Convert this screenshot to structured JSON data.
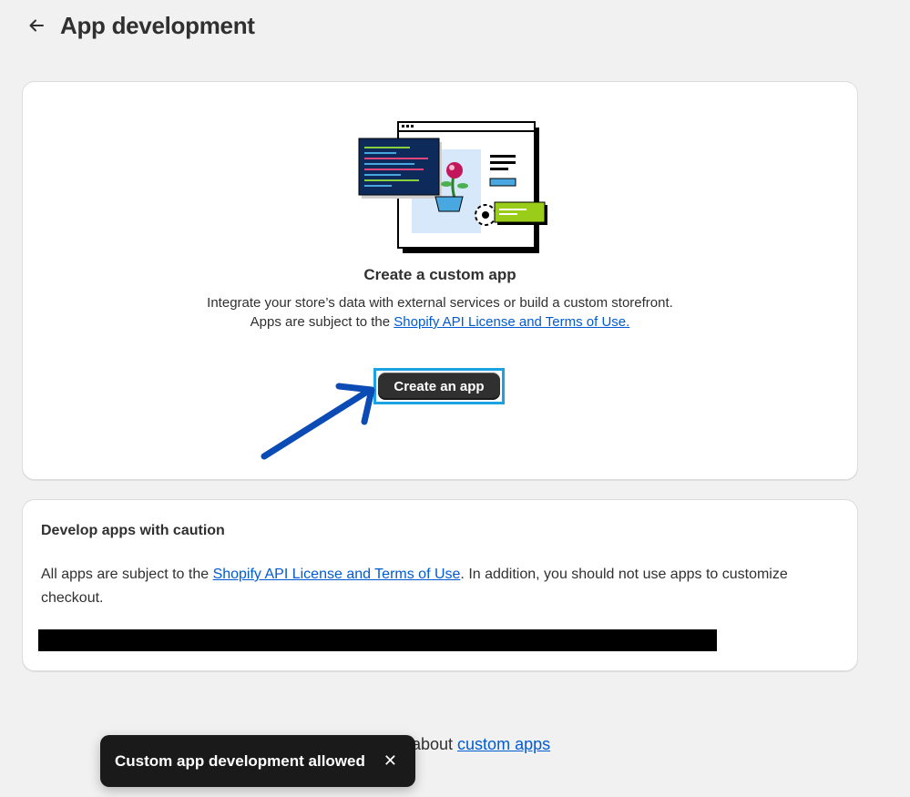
{
  "header": {
    "title": "App development",
    "back_icon": "arrow-left-icon"
  },
  "create_card": {
    "title": "Create a custom app",
    "desc_before": "Integrate your store’s data with external services or build a custom storefront. Apps are subject to the ",
    "desc_link": "Shopify API License and Terms of Use.",
    "button_label": "Create an app",
    "highlight_color": "#1aa3e0",
    "annotation_arrow_color": "#0a4bb5"
  },
  "caution_card": {
    "title": "Develop apps with caution",
    "body_before": "All apps are subject to the ",
    "body_link": "Shopify API License and Terms of Use",
    "body_after": ". In addition, you should not use apps to customize checkout."
  },
  "footer": {
    "text_before": "about ",
    "link": "custom apps"
  },
  "toast": {
    "message": "Custom app development allowed",
    "close_icon": "close-icon"
  },
  "colors": {
    "background": "#f1f1f1",
    "link": "#005bd3",
    "button": "#303030",
    "toast": "#1a1a1a"
  }
}
